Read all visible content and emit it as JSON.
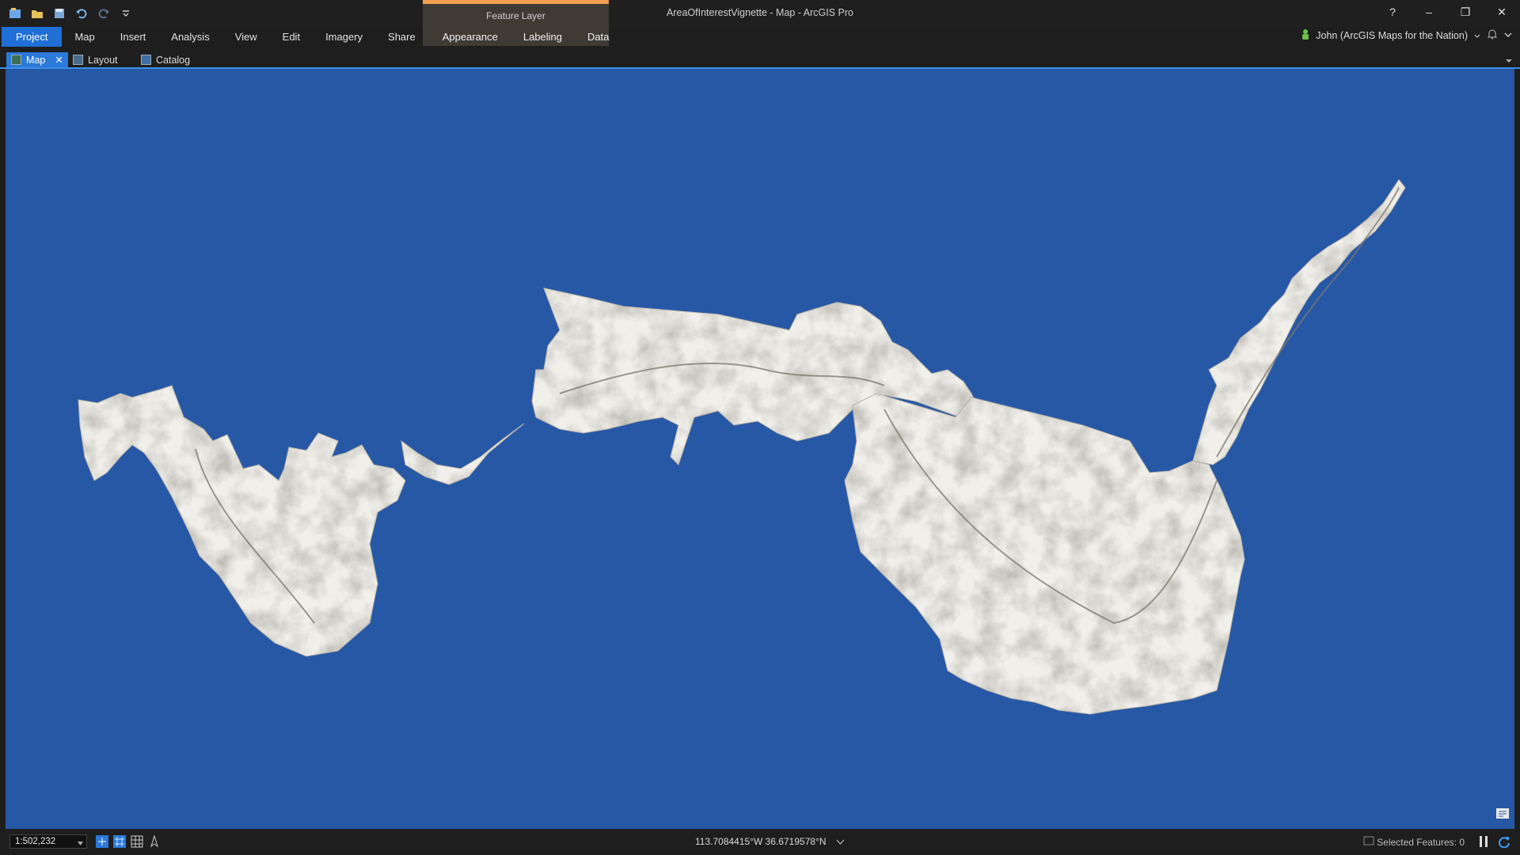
{
  "app": {
    "title": "AreaOfInterestVignette - Map - ArcGIS Pro",
    "contextual_group": "Feature Layer"
  },
  "ribbon": {
    "tabs": [
      "Project",
      "Map",
      "Insert",
      "Analysis",
      "View",
      "Edit",
      "Imagery",
      "Share"
    ],
    "contextual_tabs": [
      "Appearance",
      "Labeling",
      "Data"
    ]
  },
  "user": {
    "name": "John (ArcGIS Maps for the Nation)"
  },
  "window_controls": {
    "help": "?",
    "minimize": "–",
    "restore": "❐",
    "close": "✕"
  },
  "doc_tabs": [
    {
      "label": "Map",
      "active": true,
      "closable": true
    },
    {
      "label": "Layout",
      "active": false
    },
    {
      "label": "Catalog",
      "active": false
    }
  ],
  "map": {
    "background": "#2658a6",
    "land": "#f1efea",
    "relief": "#8e887e"
  },
  "status": {
    "scale": "1:502,232",
    "coordinates": "113.7084415°W 36.6719578°N",
    "selected_features": "Selected Features: 0"
  },
  "colors": {
    "accent": "#1f6fd6",
    "contextual": "#f0a050"
  }
}
